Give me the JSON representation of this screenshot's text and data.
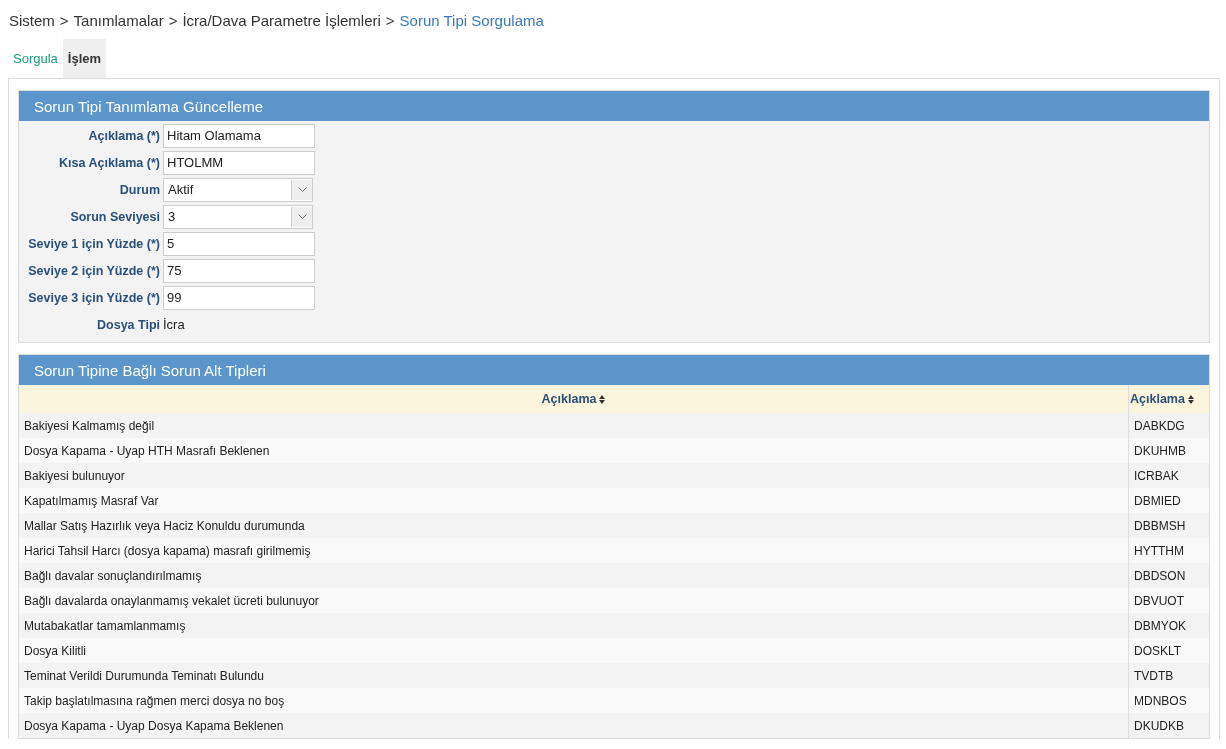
{
  "breadcrumb": {
    "items": [
      "Sistem",
      "Tanımlamalar",
      "İcra/Dava Parametre İşlemleri"
    ],
    "separator": ">",
    "current": "Sorun Tipi Sorgulama"
  },
  "tabs": [
    {
      "label": "Sorgula",
      "selected": false
    },
    {
      "label": "İşlem",
      "selected": true
    }
  ],
  "form": {
    "title": "Sorun Tipi Tanımlama Güncelleme",
    "fields": [
      {
        "kind": "text",
        "label": "Açıklama (*)",
        "value": "Hitam Olamama"
      },
      {
        "kind": "text",
        "label": "Kısa Açıklama (*)",
        "value": "HTOLMM"
      },
      {
        "kind": "select",
        "label": "Durum",
        "value": "Aktif"
      },
      {
        "kind": "select",
        "label": "Sorun Seviyesi",
        "value": "3"
      },
      {
        "kind": "text",
        "label": "Seviye 1 için Yüzde (*)",
        "value": "5"
      },
      {
        "kind": "text",
        "label": "Seviye 2 için Yüzde (*)",
        "value": "75"
      },
      {
        "kind": "text",
        "label": "Seviye 3 için Yüzde (*)",
        "value": "99"
      },
      {
        "kind": "static",
        "label": "Dosya Tipi",
        "value": "İcra"
      }
    ]
  },
  "table": {
    "title": "Sorun Tipine Bağlı Sorun Alt Tipleri",
    "columns": [
      "Açıklama",
      "Açıklama"
    ],
    "rows": [
      [
        "Bakiyesi Kalmamış değil",
        "DABKDG"
      ],
      [
        "Dosya Kapama - Uyap HTH Masrafı Beklenen",
        "DKUHMB"
      ],
      [
        "Bakiyesi bulunuyor",
        "ICRBAK"
      ],
      [
        "Kapatılmamış Masraf Var",
        "DBMIED"
      ],
      [
        "Mallar Satış Hazırlık veya Haciz Konuldu durumunda",
        "DBBMSH"
      ],
      [
        "Harici Tahsil Harcı (dosya kapama) masrafı girilmemiş",
        "HYTTHM"
      ],
      [
        "Bağlı davalar sonuçlandırılmamış",
        "DBDSON"
      ],
      [
        "Bağlı davalarda onaylanmamış vekalet ücreti bulunuyor",
        "DBVUOT"
      ],
      [
        "Mutabakatlar tamamlanmamış",
        "DBMYOK"
      ],
      [
        "Dosya Kilitli",
        "DOSKLT"
      ],
      [
        "Teminat Verildi Durumunda Teminatı Bulundu",
        "TVDTB"
      ],
      [
        "Takip başlatılmasına rağmen merci dosya no boş",
        "MDNBOS"
      ],
      [
        "Dosya Kapama - Uyap Dosya Kapama Beklenen",
        "DKUDKB"
      ]
    ]
  }
}
